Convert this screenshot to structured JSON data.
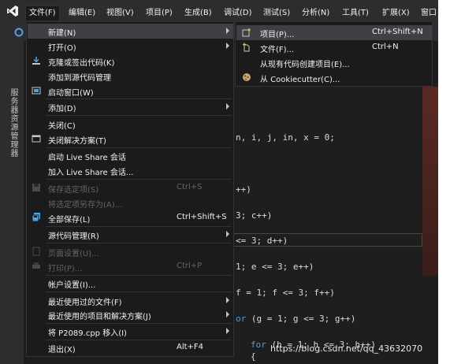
{
  "menubar": {
    "items": [
      "文件(F)",
      "编辑(E)",
      "视图(V)",
      "项目(P)",
      "生成(B)",
      "调试(D)",
      "测试(S)",
      "分析(N)",
      "工具(T)",
      "扩展(X)",
      "窗口"
    ]
  },
  "left_panel_label": "服务器资源管理器",
  "file_menu": {
    "new": "新建(N)",
    "open": "打开(O)",
    "clone": "克隆或签出代码(K)",
    "add_source_control": "添加到源代码管理",
    "start_window": "启动窗口(W)",
    "add": "添加(D)",
    "close": "关闭(C)",
    "close_solution": "关闭解决方案(T)",
    "live_share_start": "启动 Live Share 会话",
    "live_share_join": "加入 Live Share 会话...",
    "save_selected": "保存选定项(S)",
    "save_selected_shortcut": "Ctrl+S",
    "save_as": "将选定项另存为(A)...",
    "save_all": "全部保存(L)",
    "save_all_shortcut": "Ctrl+Shift+S",
    "source_control": "源代码管理(R)",
    "page_setup": "页面设置(U)...",
    "print": "打印(P)...",
    "print_shortcut": "Ctrl+P",
    "account_settings": "帐户设置(I)...",
    "recent_files": "最近使用过的文件(F)",
    "recent_projects": "最近使用的项目和解决方案(J)",
    "move_file": "将 P2089.cpp 移入(I)",
    "exit": "退出(X)",
    "exit_shortcut": "Alt+F4"
  },
  "new_submenu": {
    "project": "项目(P)...",
    "project_shortcut": "Ctrl+Shift+N",
    "file": "文件(F)...",
    "file_shortcut": "Ctrl+N",
    "from_existing": "从现有代码创建项目(E)...",
    "cookiecutter": "从 Cookiecutter(C)..."
  },
  "code_lines": {
    "l1": "n, i, j, in, x = 0;",
    "l2": "++)",
    "l3": "3; c++)",
    "l4": "<= 3; d++)",
    "l5": "1; e <= 3; e++)",
    "l6": "f = 1; f <= 3; f++)",
    "l7_kw": "or",
    "l7": " (g = 1; g <= 3; g++)",
    "l8_kw": "for",
    "l8": " (h = 1; h <= 3; h++)",
    "l9": "{"
  },
  "watermark": "https://blog.csdn.net/qq_43632070",
  "colors": {
    "menu_bg": "#1b1b1c",
    "highlight": "#3f3f46",
    "accent": "#007acc",
    "text": "#f1f1f1",
    "disabled": "#656565"
  }
}
